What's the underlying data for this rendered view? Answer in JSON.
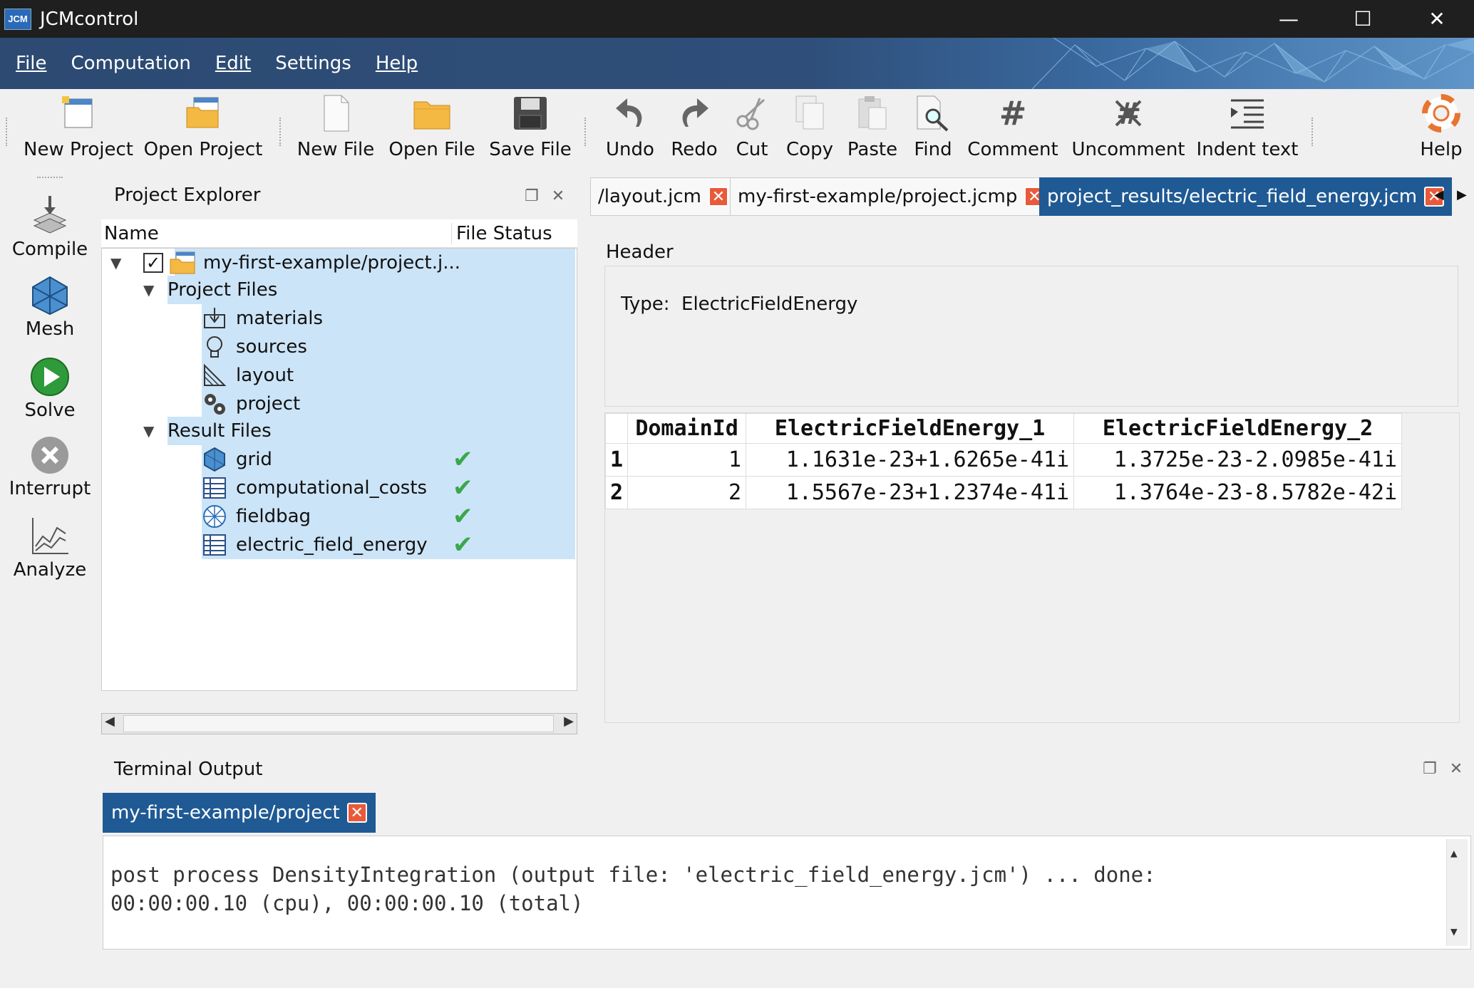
{
  "window": {
    "title": "JCMcontrol",
    "logo": "JCM"
  },
  "menu": [
    "File",
    "Computation",
    "Edit",
    "Settings",
    "Help"
  ],
  "toolbar": {
    "new_project": "New Project",
    "open_project": "Open Project",
    "new_file": "New File",
    "open_file": "Open File",
    "save_file": "Save File",
    "undo": "Undo",
    "redo": "Redo",
    "cut": "Cut",
    "copy": "Copy",
    "paste": "Paste",
    "find": "Find",
    "comment": "Comment",
    "uncomment": "Uncomment",
    "indent": "Indent text",
    "help": "Help"
  },
  "sidebar": {
    "compile": "Compile",
    "mesh": "Mesh",
    "solve": "Solve",
    "interrupt": "Interrupt",
    "analyze": "Analyze"
  },
  "explorer": {
    "title": "Project Explorer",
    "col_name": "Name",
    "col_status": "File Status",
    "root": "my-first-example/project.j...",
    "project_files": "Project Files",
    "files": [
      "materials",
      "sources",
      "layout",
      "project"
    ],
    "result_files": "Result Files",
    "results": [
      "grid",
      "computational_costs",
      "fieldbag",
      "electric_field_energy"
    ]
  },
  "editor": {
    "tabs": [
      "/layout.jcm",
      "my-first-example/project.jcmp",
      "project_results/electric_field_energy.jcm"
    ],
    "header_label": "Header",
    "type_label": "Type:",
    "type_value": "ElectricFieldEnergy",
    "table": {
      "columns": [
        "DomainId",
        "ElectricFieldEnergy_1",
        "ElectricFieldEnergy_2"
      ],
      "rows": [
        {
          "index": "1",
          "domain": "1",
          "e1": "1.1631e-23+1.6265e-41i",
          "e2": "1.3725e-23-2.0985e-41i"
        },
        {
          "index": "2",
          "domain": "2",
          "e1": "1.5567e-23+1.2374e-41i",
          "e2": "1.3764e-23-8.5782e-42i"
        }
      ]
    }
  },
  "terminal": {
    "title": "Terminal Output",
    "tab": "my-first-example/project",
    "line1": "post process DensityIntegration (output file: 'electric_field_energy.jcm') ... done:",
    "line2": "00:00:00.10 (cpu), 00:00:00.10 (total)"
  }
}
